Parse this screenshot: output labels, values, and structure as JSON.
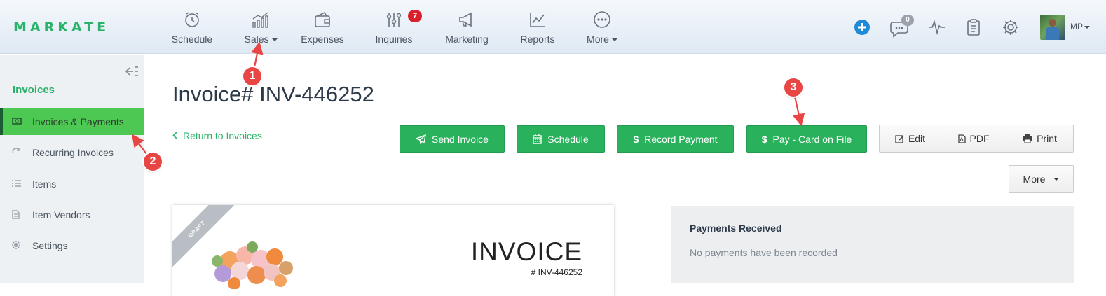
{
  "app": {
    "logo_text": "MARKATE",
    "brand_color": "#2ab26a"
  },
  "nav": {
    "items": [
      {
        "label": "Schedule",
        "icon": "alarm-clock-icon"
      },
      {
        "label": "Sales",
        "icon": "bar-chart-growth-icon",
        "has_dropdown": true
      },
      {
        "label": "Expenses",
        "icon": "wallet-icon"
      },
      {
        "label": "Inquiries",
        "icon": "sliders-icon",
        "badge": "7"
      },
      {
        "label": "Marketing",
        "icon": "megaphone-icon"
      },
      {
        "label": "Reports",
        "icon": "line-chart-icon"
      },
      {
        "label": "More",
        "icon": "ellipsis-circle-icon",
        "has_dropdown": true
      }
    ],
    "chat_badge": "0",
    "user_initials": "MP"
  },
  "sidebar": {
    "title": "Invoices",
    "items": [
      {
        "label": "Invoices & Payments",
        "icon": "money-icon",
        "active": true
      },
      {
        "label": "Recurring Invoices",
        "icon": "refresh-icon"
      },
      {
        "label": "Items",
        "icon": "list-icon"
      },
      {
        "label": "Item Vendors",
        "icon": "document-icon"
      },
      {
        "label": "Settings",
        "icon": "gear-icon"
      }
    ]
  },
  "main": {
    "title": "Invoice# INV-446252",
    "return_link": "Return to Invoices",
    "actions": {
      "send_invoice": "Send Invoice",
      "schedule": "Schedule",
      "record_payment": "Record Payment",
      "pay_card": "Pay - Card on File",
      "edit": "Edit",
      "pdf": "PDF",
      "print": "Print",
      "more": "More"
    },
    "invoice_preview": {
      "ribbon": "DRAFT",
      "heading": "INVOICE",
      "number": "# INV-446252"
    },
    "payments": {
      "title": "Payments Received",
      "empty_text": "No payments have been recorded"
    }
  },
  "annotations": {
    "marker_1": "1",
    "marker_2": "2",
    "marker_3": "3",
    "color": "#e84545"
  }
}
